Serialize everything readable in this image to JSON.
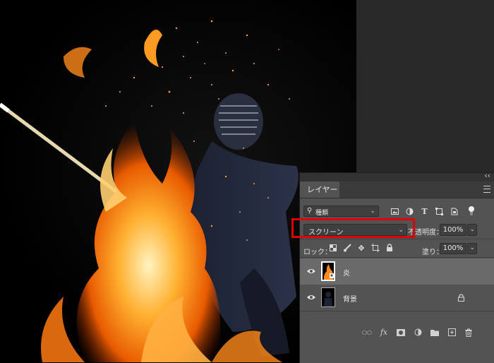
{
  "colors": {
    "panel": "#535353",
    "selected_row": "#6a6a6a",
    "highlight": "#e00000",
    "flame": "#ff8a1a"
  },
  "panel": {
    "collapse": "‹‹",
    "tab_label": "レイヤー",
    "filter": {
      "label": "種類",
      "icons": [
        "image-filter-icon",
        "adjustment-filter-icon",
        "type-filter-icon",
        "shape-filter-icon",
        "smart-object-filter-icon"
      ]
    },
    "blend_mode": "スクリーン",
    "opacity_label": "不透明度：",
    "opacity_value": "100%",
    "lock_label": "ロック：",
    "fill_label": "塗り：",
    "fill_value": "100%",
    "layers": [
      {
        "name": "炎",
        "visible": true,
        "selected": true
      },
      {
        "name": "背景",
        "visible": true,
        "selected": false,
        "locked": true
      }
    ],
    "bottom_icons": [
      "link-layers-icon",
      "fx-icon",
      "layer-mask-icon",
      "adjustment-layer-icon",
      "group-folder-icon",
      "new-layer-icon",
      "trash-icon"
    ],
    "fx_label": "fx"
  }
}
